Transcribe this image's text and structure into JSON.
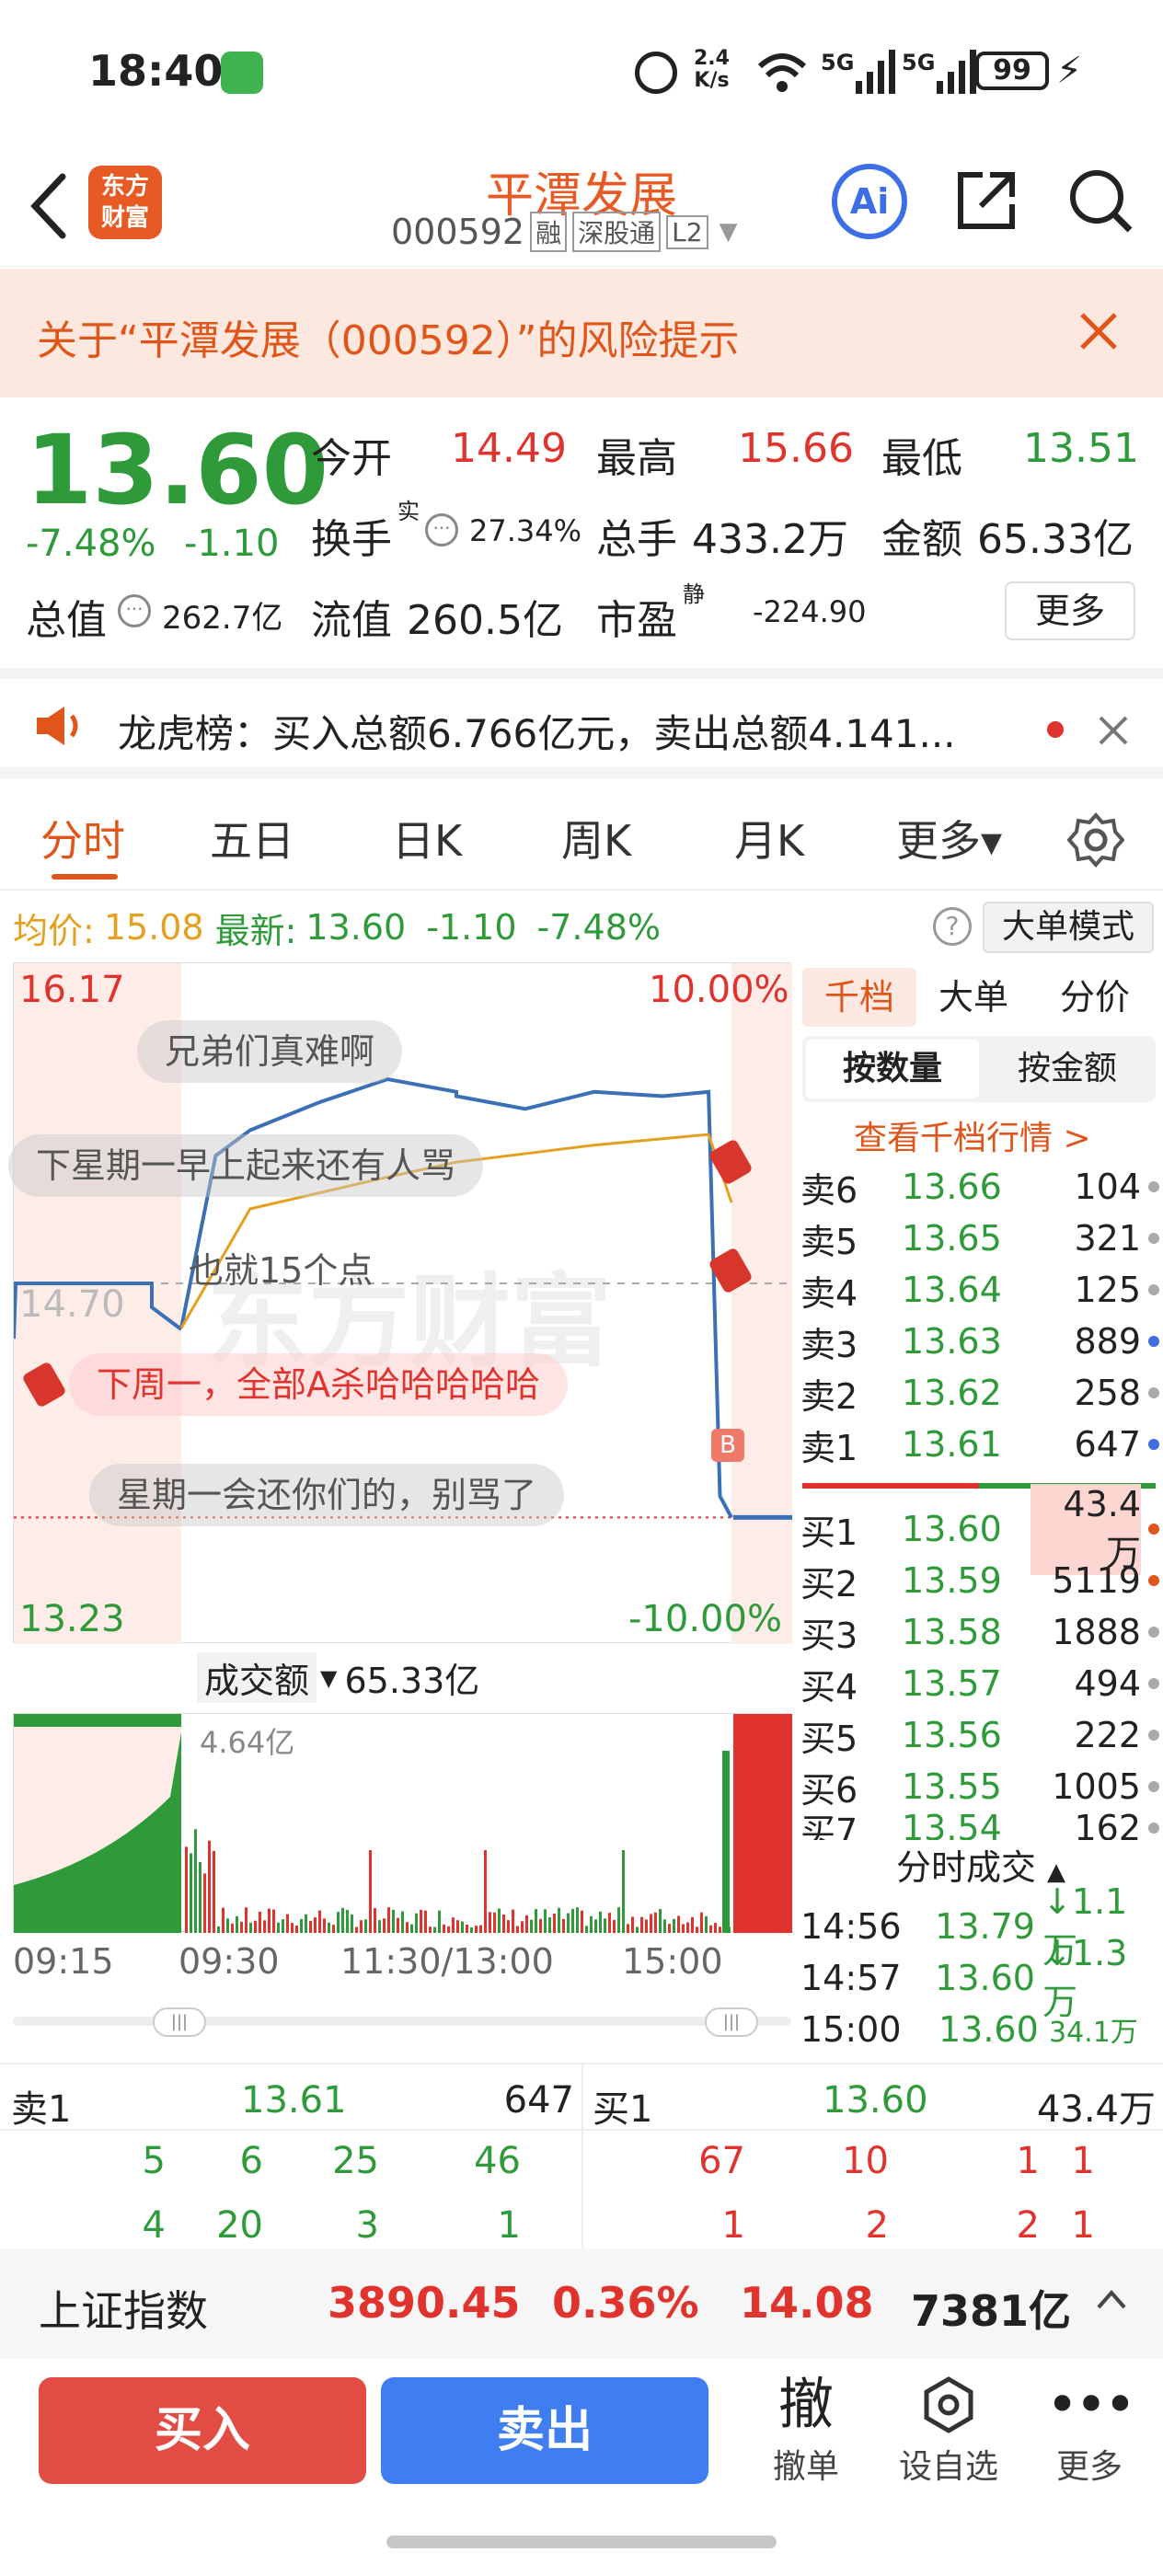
{
  "status": {
    "time": "18:40",
    "net_speed_top": "2.4",
    "net_speed_bottom": "K/s",
    "battery": "99",
    "sig1": "5G",
    "sig2": "5G"
  },
  "header": {
    "logo_top": "东方",
    "logo_bottom": "财富",
    "title": "平潭发展",
    "code": "000592",
    "tag_rong": "融",
    "tag_sgt": "深股通",
    "tag_l2": "L2",
    "ai": "Ai"
  },
  "risk": {
    "text": "关于“平潭发展（000592）”的风险提示"
  },
  "quote": {
    "price": "13.60",
    "pct": "-7.48%",
    "chg": "-1.10",
    "open_label": "今开",
    "open": "14.49",
    "high_label": "最高",
    "high": "15.66",
    "low_label": "最低",
    "low": "13.51",
    "turnover_label": "换手",
    "turnover_sup": "实",
    "turnover": "27.34%",
    "volume_label": "总手",
    "volume": "433.2万",
    "amount_label": "金额",
    "amount": "65.33亿",
    "mktcap_label": "总值",
    "mktcap": "262.7亿",
    "float_label": "流值",
    "float": "260.5亿",
    "pe_label": "市盈",
    "pe_sup": "静",
    "pe": "-224.90",
    "more": "更多"
  },
  "notice": {
    "text": "龙虎榜：买入总额6.766亿元，卖出总额4.141..."
  },
  "tabs": [
    "分时",
    "五日",
    "日K",
    "周K",
    "月K",
    "更多▾"
  ],
  "avgline": {
    "avg_label": "均价:",
    "avg": "15.08",
    "latest_label": "最新:",
    "latest": "13.60",
    "chg": "-1.10",
    "pct": "-7.48%",
    "mode": "大单模式"
  },
  "chart": {
    "ymax": "16.17",
    "ymin": "13.23",
    "pct_top": "10.00%",
    "pct_bottom": "-10.00%",
    "mid": "14.70",
    "b_marker": "B",
    "watermark": "东方财富"
  },
  "chart_data": {
    "type": "line",
    "title": "",
    "ylim": [
      13.23,
      16.17
    ],
    "series": [
      {
        "name": "",
        "x": [
          "09:30",
          "09:45",
          "10:00",
          "10:30",
          "11:00",
          "11:30",
          "13:00",
          "13:30",
          "14:00",
          "14:30",
          "14:50",
          "14:55",
          "15:00"
        ],
        "values": [
          14.49,
          15.3,
          15.42,
          15.55,
          15.66,
          15.6,
          15.58,
          15.52,
          15.6,
          15.58,
          15.6,
          13.7,
          13.6
        ]
      },
      {
        "name": "均价",
        "x": [
          "09:30",
          "10:00",
          "11:00",
          "13:00",
          "14:00",
          "14:50",
          "15:00"
        ],
        "values": [
          14.49,
          15.05,
          15.2,
          15.27,
          15.35,
          15.4,
          15.08
        ]
      }
    ]
  },
  "danmaku": [
    "兄弟们真难啊",
    "下星期一早上起来还有人骂",
    "也就15个点",
    "下周一，全部A杀哈哈哈哈哈",
    "星期一会还你们的，别骂了"
  ],
  "orderbook": {
    "tabs": [
      "千档",
      "大单",
      "分价"
    ],
    "subtabs": [
      "按数量",
      "按金额"
    ],
    "link": "查看千档行情 >",
    "asks": [
      {
        "label": "卖6",
        "price": "13.66",
        "vol": "104"
      },
      {
        "label": "卖5",
        "price": "13.65",
        "vol": "321"
      },
      {
        "label": "卖4",
        "price": "13.64",
        "vol": "125"
      },
      {
        "label": "卖3",
        "price": "13.63",
        "vol": "889"
      },
      {
        "label": "卖2",
        "price": "13.62",
        "vol": "258"
      },
      {
        "label": "卖1",
        "price": "13.61",
        "vol": "647"
      }
    ],
    "bids": [
      {
        "label": "买1",
        "price": "13.60",
        "vol": "43.4万"
      },
      {
        "label": "买2",
        "price": "13.59",
        "vol": "5119"
      },
      {
        "label": "买3",
        "price": "13.58",
        "vol": "1888"
      },
      {
        "label": "买4",
        "price": "13.57",
        "vol": "494"
      },
      {
        "label": "买5",
        "price": "13.56",
        "vol": "222"
      },
      {
        "label": "买6",
        "price": "13.55",
        "vol": "1005"
      },
      {
        "label": "买7",
        "price": "13.54",
        "vol": "162"
      }
    ],
    "ticks_title": "分时成交",
    "ticks": [
      {
        "time": "14:56",
        "price": "13.79",
        "vol": "↓1.1万"
      },
      {
        "time": "14:57",
        "price": "13.60",
        "vol": "↓1.3万"
      },
      {
        "time": "15:00",
        "price": "13.60",
        "vol": "34.1万"
      }
    ]
  },
  "volume": {
    "label": "成交额",
    "total": "65.33亿",
    "max": "4.64亿"
  },
  "times": [
    "09:15",
    "09:30",
    "11:30/13:00",
    "15:00"
  ],
  "level2": {
    "sell_label": "卖1",
    "sell_price": "13.61",
    "sell_vol": "647",
    "buy_label": "买1",
    "buy_price": "13.60",
    "buy_vol": "43.4万",
    "sell_q1": [
      "5",
      "6",
      "25",
      "46"
    ],
    "sell_q2": [
      "4",
      "20",
      "3",
      "1"
    ],
    "buy_q1": [
      "67",
      "10",
      "1",
      "1"
    ],
    "buy_q2": [
      "1",
      "2",
      "2",
      "1"
    ]
  },
  "index": {
    "name": "上证指数",
    "value": "3890.45",
    "pct": "0.36%",
    "chg": "14.08",
    "amount": "7381亿"
  },
  "bottom": {
    "buy": "买入",
    "sell": "卖出",
    "cancel_big": "撤",
    "cancel": "撤单",
    "watch": "设自选",
    "more": "更多"
  }
}
